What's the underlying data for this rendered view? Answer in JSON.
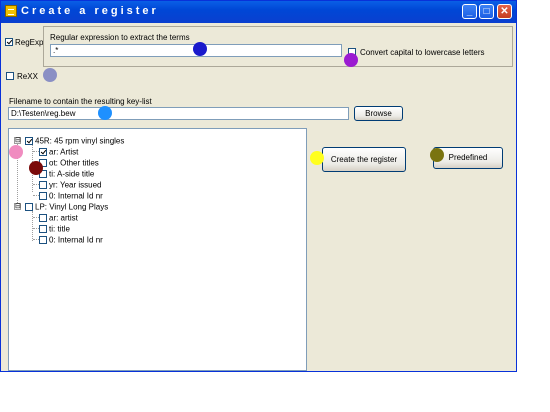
{
  "window": {
    "title": "Create a register",
    "controls": {
      "minimize": "_",
      "maximize": "□",
      "close": "✕"
    }
  },
  "regexp": {
    "checkbox_label": "RegExp",
    "checked": true,
    "prompt": "Regular expression to extract the terms",
    "value": ".*",
    "convert_label": "Convert capital to lowercase letters",
    "convert_checked": false
  },
  "rexx": {
    "checkbox_label": "ReXX",
    "checked": false
  },
  "filename": {
    "label": "Filename to contain the resulting key-list",
    "value": "D:\\Testen\\reg.bew",
    "browse_label": "Browse"
  },
  "tree": {
    "groups": [
      {
        "label": "45R: 45 rpm vinyl singles",
        "checked": true,
        "expander": "⊟",
        "items": [
          {
            "label": "ar: Artist",
            "checked": true
          },
          {
            "label": "ot: Other titles",
            "checked": false
          },
          {
            "label": "ti: A-side title",
            "checked": false
          },
          {
            "label": "yr: Year issued",
            "checked": false
          },
          {
            "label": "0: Internal Id nr",
            "checked": false
          }
        ]
      },
      {
        "label": "LP: Vinyl Long Plays",
        "checked": false,
        "expander": "⊟",
        "items": [
          {
            "label": "ar: artist",
            "checked": false
          },
          {
            "label": "ti: title",
            "checked": false
          },
          {
            "label": "0: Internal Id nr",
            "checked": false
          }
        ]
      }
    ]
  },
  "actions": {
    "create_label": "Create the register",
    "predefined_label": "Predefined"
  },
  "markers": {
    "colors": {
      "blue": "#1a1acc",
      "purple": "#9b1ad1",
      "slate": "#8a8fc4",
      "sky": "#1e90ff",
      "pink": "#f08cc0",
      "maroon": "#7a0a0a",
      "yellow": "#ffff1e",
      "olive": "#7a7410"
    }
  }
}
